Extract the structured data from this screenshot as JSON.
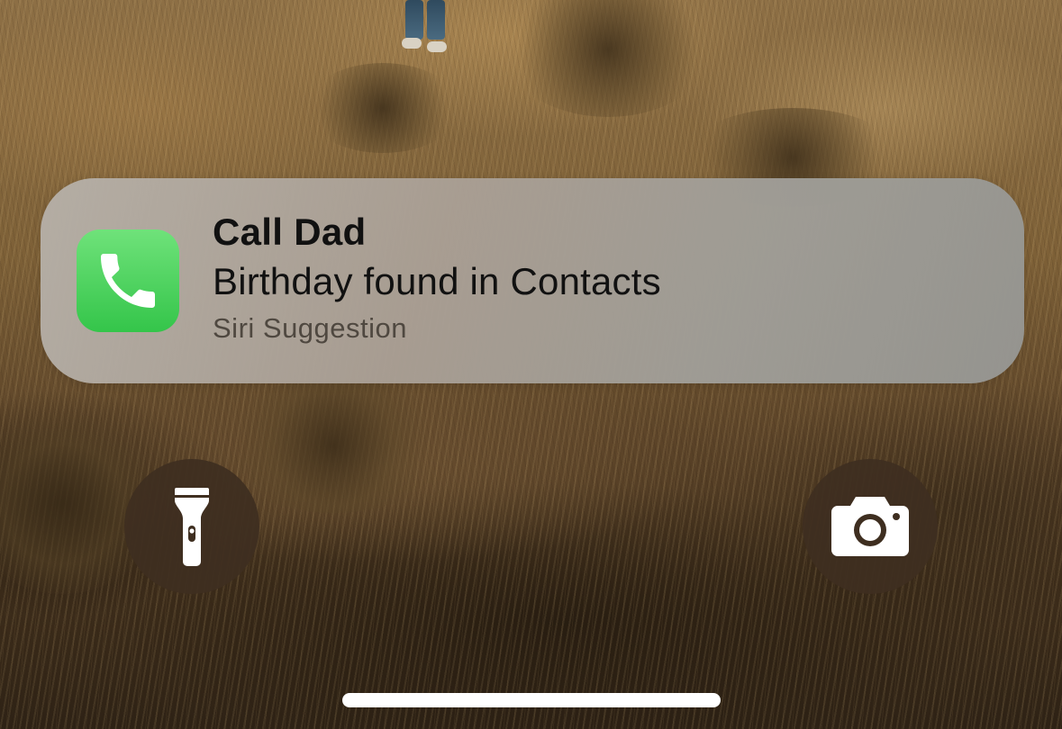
{
  "suggestion": {
    "title": "Call Dad",
    "subtitle": "Birthday found in Contacts",
    "source": "Siri Suggestion",
    "app_icon": "phone-icon",
    "icon_color": "#34c54a"
  },
  "quick_actions": {
    "left": {
      "icon": "flashlight-icon"
    },
    "right": {
      "icon": "camera-icon"
    }
  },
  "colors": {
    "card_background": "#aca59d",
    "action_button": "#3e2e20",
    "home_indicator": "#ffffff"
  }
}
